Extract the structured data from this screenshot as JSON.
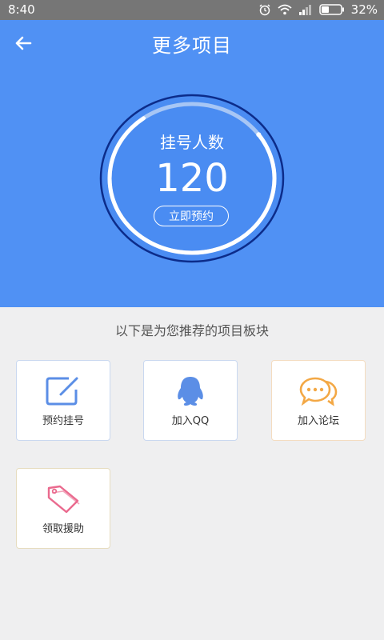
{
  "status_bar": {
    "time": "8:40",
    "battery": "32%"
  },
  "header": {
    "title": "更多项目"
  },
  "ring": {
    "label": "挂号人数",
    "count": "120",
    "button": "立即预约",
    "progress": 0.25
  },
  "section": {
    "title": "以下是为您推荐的项目板块"
  },
  "cards": [
    {
      "label": "预约挂号",
      "icon": "edit-icon"
    },
    {
      "label": "加入QQ",
      "icon": "qq-icon"
    },
    {
      "label": "加入论坛",
      "icon": "chat-bubbles-icon"
    },
    {
      "label": "领取援助",
      "icon": "tag-icon"
    }
  ],
  "colors": {
    "header_bg": "#5091f4",
    "ring_dark": "#0c2c8a",
    "status_bg": "#767676"
  }
}
